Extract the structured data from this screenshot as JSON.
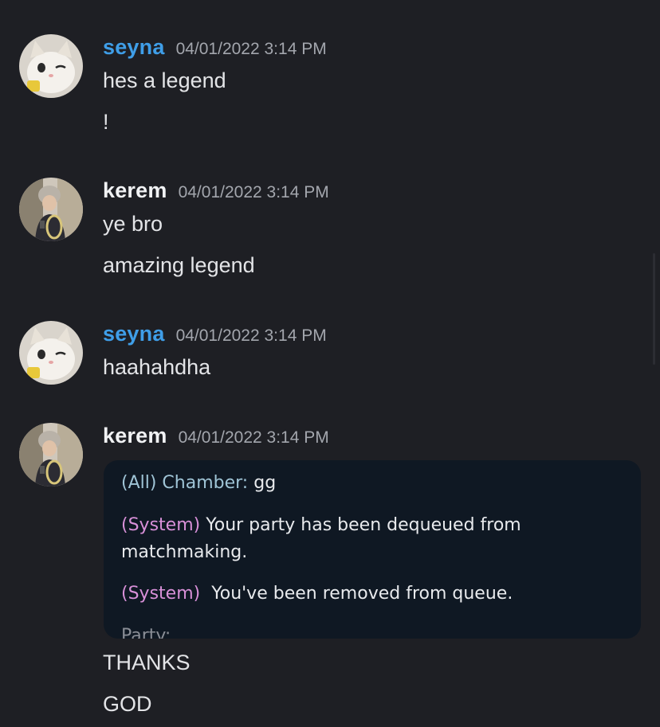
{
  "messages": [
    {
      "author": "seyna",
      "timestamp": "04/01/2022 3:14 PM",
      "lines": [
        "hes a legend",
        "!"
      ]
    },
    {
      "author": "kerem",
      "timestamp": "04/01/2022 3:14 PM",
      "lines": [
        "ye bro",
        "amazing legend"
      ]
    },
    {
      "author": "seyna",
      "timestamp": "04/01/2022 3:14 PM",
      "lines": [
        "haahahdha"
      ]
    },
    {
      "author": "kerem",
      "timestamp": "04/01/2022 3:14 PM",
      "attachment": {
        "lines": [
          {
            "tag": "(All) Chamber:",
            "text": " gg"
          },
          {
            "tag": "(System)",
            "text": "Your party has been dequeued from"
          },
          {
            "tag": "",
            "text": "matchmaking."
          },
          {
            "tag": "(System)",
            "text": "You've been removed from queue."
          },
          {
            "tag": "Party:",
            "text": ""
          }
        ]
      },
      "lines": [
        "THANKS",
        "GOD"
      ]
    }
  ],
  "colors": {
    "background": "#1e1f24",
    "seyna_name": "#3f9ee8",
    "kerem_name": "#f1f2f4",
    "timestamp": "#a3a6ad",
    "system_tag": "#d890d8",
    "all_tag": "#9fc4d6"
  },
  "icons": {
    "seyna_avatar": "cat-avatar-icon",
    "kerem_avatar": "person-avatar-icon"
  }
}
